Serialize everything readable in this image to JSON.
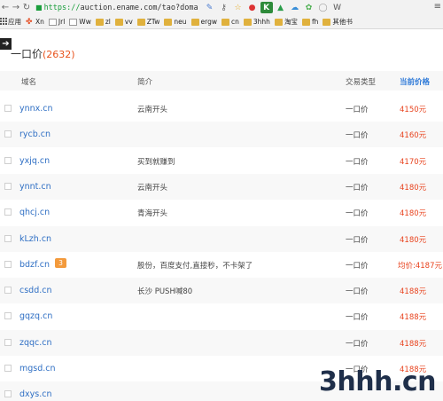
{
  "browser": {
    "url_scheme": "https://",
    "url_rest": "auction.ename.com/tao?doma",
    "bookmarks": [
      "应用",
      "Xn",
      "Jrl",
      "Ww",
      "zl",
      "vv",
      "ZTw",
      "neu",
      "ergw",
      "cn",
      "3hhh",
      "淘宝",
      "fh",
      "其他书"
    ]
  },
  "page": {
    "title": "一口价",
    "count": "(2632)"
  },
  "table": {
    "headers": {
      "domain": "域名",
      "intro": "简介",
      "type": "交易类型",
      "price": "当前价格"
    },
    "rows": [
      {
        "domain": "ynnx.cn",
        "intro": "云南开头",
        "type": "一口价",
        "price": "4150元"
      },
      {
        "domain": "rycb.cn",
        "intro": "",
        "type": "一口价",
        "price": "4160元"
      },
      {
        "domain": "yxjq.cn",
        "intro": "买到就赚到",
        "type": "一口价",
        "price": "4170元"
      },
      {
        "domain": "ynnt.cn",
        "intro": "云南开头",
        "type": "一口价",
        "price": "4180元"
      },
      {
        "domain": "qhcj.cn",
        "intro": "青海开头",
        "type": "一口价",
        "price": "4180元"
      },
      {
        "domain": "kLzh.cn",
        "intro": "",
        "type": "一口价",
        "price": "4180元"
      },
      {
        "domain": "bdzf.cn",
        "tag": "3",
        "intro": "股份，百度支付,直接秒，不卡架了",
        "type": "一口价",
        "price": "均价:4187元"
      },
      {
        "domain": "csdd.cn",
        "intro": "长沙 PUSH喊80",
        "type": "一口价",
        "price": "4188元"
      },
      {
        "domain": "gqzq.cn",
        "intro": "",
        "type": "一口价",
        "price": "4188元"
      },
      {
        "domain": "zqqc.cn",
        "intro": "",
        "type": "一口价",
        "price": "4188元"
      },
      {
        "domain": "mgsd.cn",
        "intro": "",
        "type": "一口价",
        "price": "4188元"
      },
      {
        "domain": "dxys.cn",
        "intro": "",
        "type": "",
        "price": ""
      }
    ]
  },
  "watermark": "3hhh.cn",
  "colors": {
    "link": "#2f6fc4",
    "price": "#e8431e",
    "accent": "#2f7ad8",
    "tag": "#f39a3c"
  }
}
